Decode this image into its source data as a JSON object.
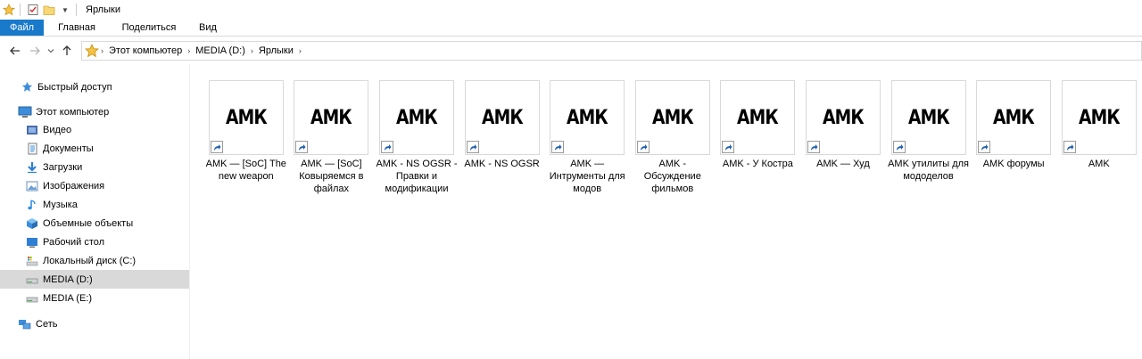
{
  "window": {
    "title": "Ярлыки"
  },
  "ribbon": {
    "tabs": [
      "Файл",
      "Главная",
      "Поделиться",
      "Вид"
    ]
  },
  "address": {
    "crumbs": [
      "Этот компьютер",
      "MEDIA (D:)",
      "Ярлыки"
    ]
  },
  "sidebar": {
    "quick_access": "Быстрый доступ",
    "this_pc": "Этот компьютер",
    "items": [
      {
        "label": "Видео",
        "icon": "video-folder-icon"
      },
      {
        "label": "Документы",
        "icon": "documents-folder-icon"
      },
      {
        "label": "Загрузки",
        "icon": "downloads-folder-icon"
      },
      {
        "label": "Изображения",
        "icon": "pictures-folder-icon"
      },
      {
        "label": "Музыка",
        "icon": "music-folder-icon"
      },
      {
        "label": "Объемные объекты",
        "icon": "3d-objects-folder-icon"
      },
      {
        "label": "Рабочий стол",
        "icon": "desktop-folder-icon"
      },
      {
        "label": "Локальный диск (C:)",
        "icon": "local-disk-icon"
      },
      {
        "label": "MEDIA (D:)",
        "icon": "drive-icon"
      },
      {
        "label": "MEDIA (E:)",
        "icon": "drive-icon"
      }
    ],
    "network": "Сеть",
    "selected": "MEDIA (D:)"
  },
  "files": [
    {
      "thumb": "АМК",
      "label": "AMK — [SoC] The new weapon"
    },
    {
      "thumb": "АМК",
      "label": "AMK — [SoC] Ковыряемся в файлах"
    },
    {
      "thumb": "АМК",
      "label": "AMK - NS OGSR - Правки и модификации"
    },
    {
      "thumb": "АМК",
      "label": "AMK - NS OGSR"
    },
    {
      "thumb": "АМК",
      "label": "AMK — Интрументы для модов"
    },
    {
      "thumb": "АМК",
      "label": "AMK - Обсуждение фильмов"
    },
    {
      "thumb": "АМК",
      "label": "AMK - У Костра"
    },
    {
      "thumb": "АМК",
      "label": "AMK — Худ"
    },
    {
      "thumb": "АМК",
      "label": "AMK утилиты для мододелов"
    },
    {
      "thumb": "АМК",
      "label": "AMK форумы"
    },
    {
      "thumb": "АМК",
      "label": "AMK"
    }
  ],
  "colors": {
    "file_tab": "#1979ca",
    "selected_bg": "#d9d9d9",
    "shortcut_arrow": "#1f5fb0"
  }
}
